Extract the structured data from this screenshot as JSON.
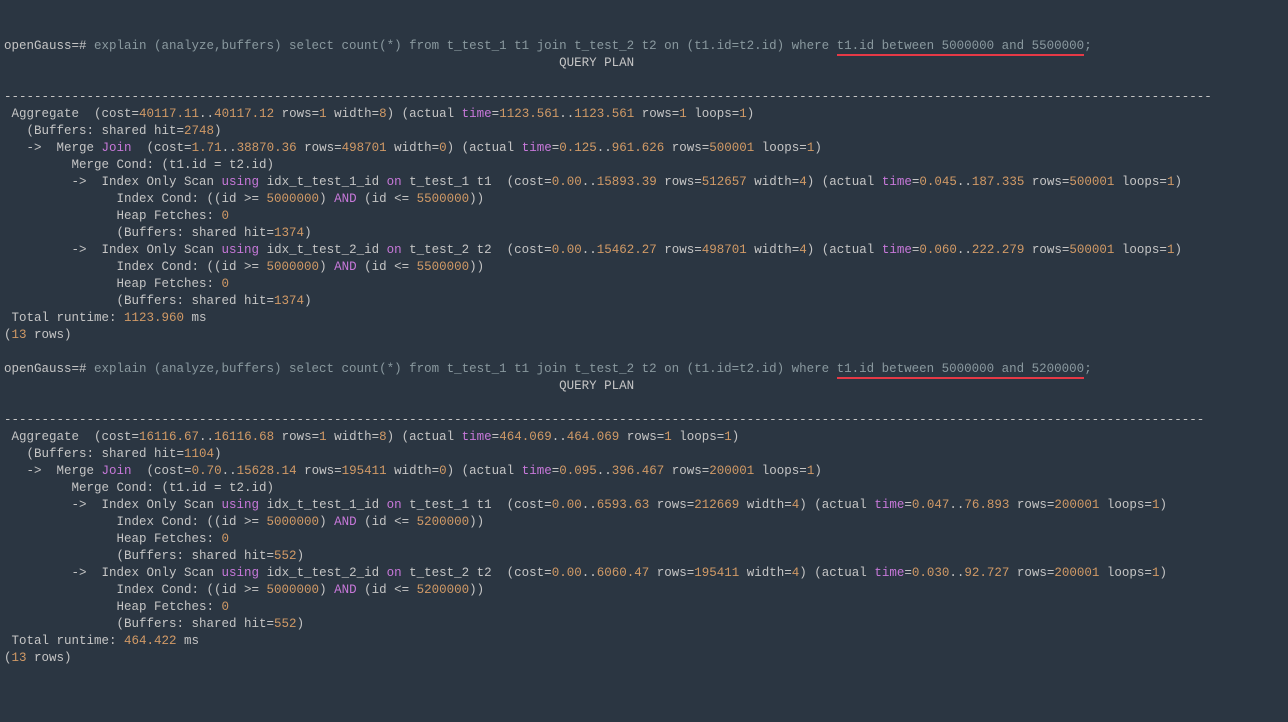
{
  "q1": {
    "prompt": "openGauss=#",
    "sql_pre": " explain (analyze,buffers) select count(*) from t_test_1 t1 join t_test_2 t2 on (t1.id=t2.id) where ",
    "sql_underlined": "t1.id between 5000000 and 5500000",
    "sql_end": ";",
    "header": "                                                                          QUERY PLAN",
    "dashes": "-----------------------------------------------------------------------------------------------------------------------------------------------------------------",
    "plan": {
      "agg_cost1": "40117.11",
      "agg_cost2": "40117.12",
      "agg_rows": "1",
      "agg_width": "8",
      "agg_time1": "1123.561",
      "agg_time2": "1123.561",
      "agg_arows": "1",
      "agg_loops": "1",
      "agg_buffers": "2748",
      "mj_cost1": "1.71",
      "mj_cost2": "38870.36",
      "mj_rows": "498701",
      "mj_width": "0",
      "mj_time1": "0.125",
      "mj_time2": "961.626",
      "mj_arows": "500001",
      "mj_loops": "1",
      "ios1_idx": "idx_t_test_1_id",
      "ios1_tbl": "t_test_1 t1",
      "ios1_cost1": "0.00",
      "ios1_cost2": "15893.39",
      "ios1_rows": "512657",
      "ios1_width": "4",
      "ios1_time1": "0.045",
      "ios1_time2": "187.335",
      "ios1_arows": "500001",
      "ios1_loops": "1",
      "ios1_lo": "5000000",
      "ios1_hi": "5500000",
      "ios1_heap": "0",
      "ios1_buf": "1374",
      "ios2_idx": "idx_t_test_2_id",
      "ios2_tbl": "t_test_2 t2",
      "ios2_cost1": "0.00",
      "ios2_cost2": "15462.27",
      "ios2_rows": "498701",
      "ios2_width": "4",
      "ios2_time1": "0.060",
      "ios2_time2": "222.279",
      "ios2_arows": "500001",
      "ios2_loops": "1",
      "ios2_lo": "5000000",
      "ios2_hi": "5500000",
      "ios2_heap": "0",
      "ios2_buf": "1374",
      "runtime": "1123.960",
      "rowcount": "13"
    }
  },
  "q2": {
    "prompt": "openGauss=#",
    "sql_pre": " explain (analyze,buffers) select count(*) from t_test_1 t1 join t_test_2 t2 on (t1.id=t2.id) where ",
    "sql_underlined": "t1.id between 5000000 and 5200000",
    "sql_end": ";",
    "header": "                                                                          QUERY PLAN",
    "dashes": "----------------------------------------------------------------------------------------------------------------------------------------------------------------",
    "plan": {
      "agg_cost1": "16116.67",
      "agg_cost2": "16116.68",
      "agg_rows": "1",
      "agg_width": "8",
      "agg_time1": "464.069",
      "agg_time2": "464.069",
      "agg_arows": "1",
      "agg_loops": "1",
      "agg_buffers": "1104",
      "mj_cost1": "0.70",
      "mj_cost2": "15628.14",
      "mj_rows": "195411",
      "mj_width": "0",
      "mj_time1": "0.095",
      "mj_time2": "396.467",
      "mj_arows": "200001",
      "mj_loops": "1",
      "ios1_idx": "idx_t_test_1_id",
      "ios1_tbl": "t_test_1 t1",
      "ios1_cost1": "0.00",
      "ios1_cost2": "6593.63",
      "ios1_rows": "212669",
      "ios1_width": "4",
      "ios1_time1": "0.047",
      "ios1_time2": "76.893",
      "ios1_arows": "200001",
      "ios1_loops": "1",
      "ios1_lo": "5000000",
      "ios1_hi": "5200000",
      "ios1_heap": "0",
      "ios1_buf": "552",
      "ios2_idx": "idx_t_test_2_id",
      "ios2_tbl": "t_test_2 t2",
      "ios2_cost1": "0.00",
      "ios2_cost2": "6060.47",
      "ios2_rows": "195411",
      "ios2_width": "4",
      "ios2_time1": "0.030",
      "ios2_time2": "92.727",
      "ios2_arows": "200001",
      "ios2_loops": "1",
      "ios2_lo": "5000000",
      "ios2_hi": "5200000",
      "ios2_heap": "0",
      "ios2_buf": "552",
      "runtime": "464.422",
      "rowcount": "13"
    }
  }
}
